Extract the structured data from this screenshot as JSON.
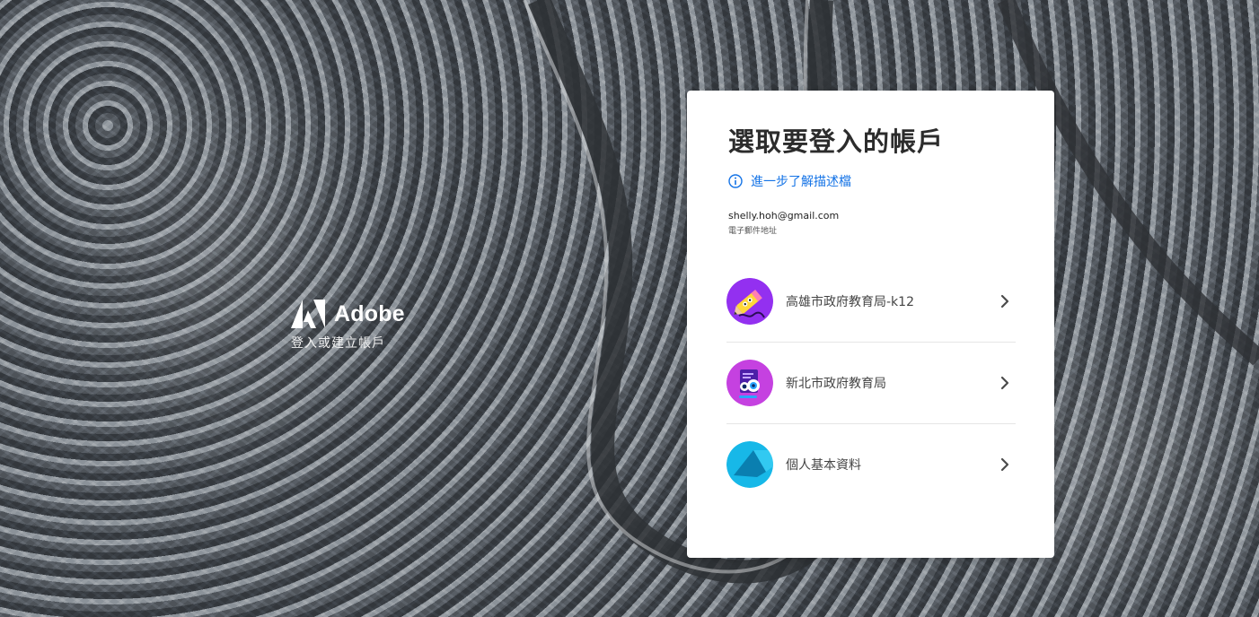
{
  "brand": {
    "name": "Adobe",
    "subtitle": "登入或建立帳戶"
  },
  "card": {
    "title": "選取要登入的帳戶",
    "learn_more": "進一步了解描述檔",
    "email": "shelly.hoh@gmail.com",
    "email_label": "電子郵件地址",
    "accounts": [
      {
        "name": "高雄市政府教育局-k12",
        "icon": "pencil-avatar-icon"
      },
      {
        "name": "新北市政府教育局",
        "icon": "document-avatar-icon"
      },
      {
        "name": "個人基本資料",
        "icon": "personal-avatar-icon"
      }
    ]
  },
  "colors": {
    "link": "#1473e6",
    "annotation": "#d9261c",
    "avatar_purple": "#7b2cf0",
    "avatar_cyan": "#17b8e8"
  }
}
